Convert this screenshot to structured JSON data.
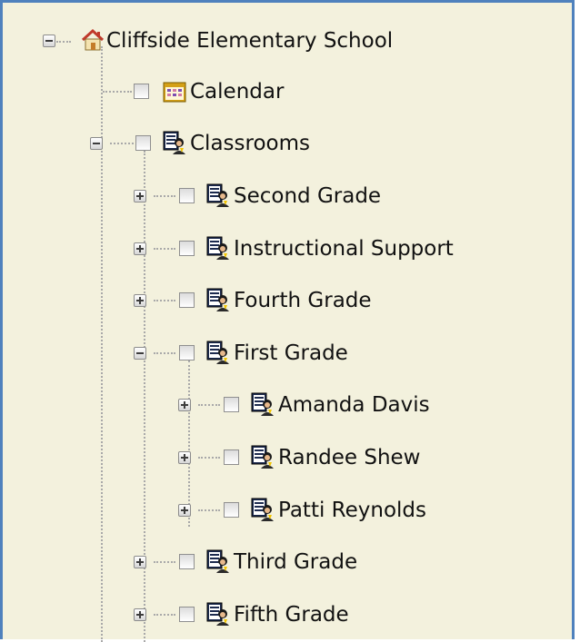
{
  "tree": {
    "root": {
      "label": "Cliffside Elementary School",
      "icon": "home-icon"
    },
    "calendar": {
      "label": "Calendar",
      "icon": "calendar-icon"
    },
    "classrooms": {
      "label": "Classrooms",
      "icon": "classroom-icon",
      "children": [
        {
          "label": "Second Grade",
          "icon": "classroom-icon"
        },
        {
          "label": "Instructional Support",
          "icon": "classroom-icon"
        },
        {
          "label": "Fourth Grade",
          "icon": "classroom-icon"
        },
        {
          "label": "First Grade",
          "icon": "classroom-icon",
          "children": [
            {
              "label": "Amanda Davis",
              "icon": "classroom-icon"
            },
            {
              "label": "Randee Shew",
              "icon": "classroom-icon"
            },
            {
              "label": "Patti Reynolds",
              "icon": "classroom-icon"
            }
          ]
        },
        {
          "label": "Third Grade",
          "icon": "classroom-icon"
        },
        {
          "label": "Fifth Grade",
          "icon": "classroom-icon"
        }
      ]
    }
  },
  "colors": {
    "background": "#f3f1dd",
    "border": "#4f81bd",
    "house_roof": "#c0392b",
    "calendar": "#d4a017"
  }
}
